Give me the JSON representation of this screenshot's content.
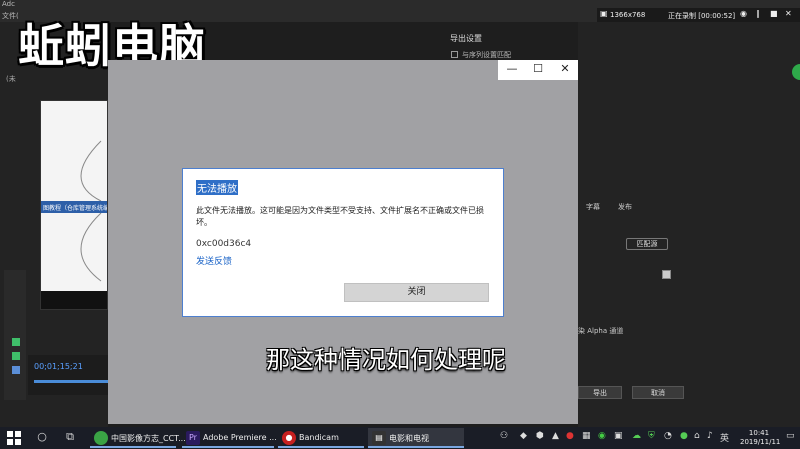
{
  "watermark": "蚯蚓电脑",
  "premiere": {
    "app_name": "Adc",
    "menu_file": "文件(",
    "left_untitled": "(未",
    "thumb_banner": "图教程（仓库管理系统编",
    "timecode": "00;01;15;21",
    "export_settings_title": "导出设置",
    "match_sequence": "与序列设置匹配",
    "tabs": [
      "字幕",
      "发布"
    ],
    "match_source_button": "匹配源",
    "render_alpha": "染 Alpha 通道",
    "export_button": "导出",
    "cancel_button": "取消"
  },
  "recorder": {
    "resolution": "1366x768",
    "status": "正在录制 [00:00:52]"
  },
  "movies_tv": {
    "controls": [
      "—",
      "☐",
      "✕"
    ]
  },
  "dialog": {
    "title": "无法播放",
    "message": "此文件无法播放。这可能是因为文件类型不受支持、文件扩展名不正确或文件已损坏。",
    "error_code": "0xc00d36c4",
    "feedback_link": "发送反馈",
    "close_button": "关闭"
  },
  "subtitle": "那这种情况如何处理呢",
  "taskbar": {
    "apps": [
      {
        "label": "中国影像方志_CCT...",
        "color": "#3aa345",
        "icon": "chrome-icon"
      },
      {
        "label": "Adobe Premiere ...",
        "color": "#2a1a5e",
        "icon": "premiere-icon"
      },
      {
        "label": "Bandicam",
        "color": "#c62020",
        "icon": "bandicam-icon"
      },
      {
        "label": "电影和电视",
        "color": "#333",
        "icon": "clapperboard-icon"
      }
    ],
    "ime": "英",
    "time": "10:41",
    "date": "2019/11/11"
  },
  "colors": {
    "dialog_border": "#4d7fcf",
    "link": "#1a63c7",
    "window_bg": "#a1a1a4"
  }
}
